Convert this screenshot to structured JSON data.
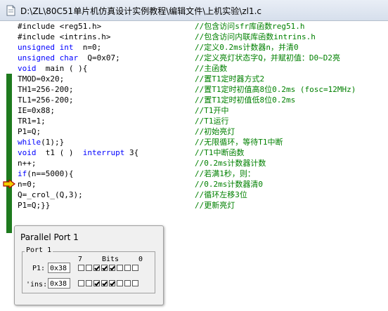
{
  "window": {
    "title": "D:\\ZL\\80C51单片机仿真设计实例教程\\编辑文件\\上机实验\\zl1.c"
  },
  "code_lines": [
    {
      "code": "#include <reg51.h>",
      "comment": "//包含访问sfr库函数reg51.h"
    },
    {
      "code": "#include <intrins.h>",
      "comment": "//包含访问内联库函数intrins.h"
    },
    {
      "code": "unsigned int  n=0;",
      "comment": "//定义0.2ms计数器n，并清0"
    },
    {
      "code": "unsigned char  Q=0x07;",
      "comment": "//定义亮灯状态字Q，并赋初值：D0~D2亮"
    },
    {
      "code": "void  main ( ){",
      "comment": "//主函数"
    },
    {
      "code": "TMOD=0x20;",
      "comment": "//置T1定时器方式2"
    },
    {
      "code": "TH1=256-200;",
      "comment": "//置T1定时初值高8位0.2ms (fosc=12MHz)"
    },
    {
      "code": "TL1=256-200;",
      "comment": "//置T1定时初值低8位0.2ms"
    },
    {
      "code": "IE=0x88;",
      "comment": "//T1开中"
    },
    {
      "code": "TR1=1;",
      "comment": "//T1运行"
    },
    {
      "code": "P1=Q;",
      "comment": "//初始亮灯"
    },
    {
      "code": "while(1);}",
      "comment": "//无限循环，等待T1中断"
    },
    {
      "code": "void  t1 ( )  interrupt 3{",
      "comment": "//T1中断函数"
    },
    {
      "code": "n++;",
      "comment": "//0.2ms计数器计数"
    },
    {
      "code": "if(n==5000){",
      "comment": "//若满1秒，则："
    },
    {
      "code": "n=0;",
      "comment": "//0.2ms计数器清0"
    },
    {
      "code": "Q=_crol_(Q,3);",
      "comment": "//循环左移3位"
    },
    {
      "code": "P1=Q;}}",
      "comment": "//更新亮灯"
    }
  ],
  "dialog": {
    "title": "Parallel Port 1",
    "group_label": "Port 1",
    "p1_label": "P1:",
    "p1_value": "0x38",
    "pins_label": "'ins:",
    "pins_value": "0x38",
    "bits_hi": "7",
    "bits_word": "Bits",
    "bits_lo": "0",
    "p1_bits": [
      0,
      0,
      1,
      1,
      1,
      0,
      0,
      0
    ],
    "pins_bits": [
      0,
      0,
      1,
      1,
      1,
      0,
      0,
      0
    ]
  },
  "colors": {
    "code": "#000000",
    "keyword": "#0000ff",
    "comment": "#008000",
    "gutter": "#1e7a1e"
  },
  "icons": {
    "title": "c-file-icon",
    "current_line": "execution-arrow-icon"
  }
}
